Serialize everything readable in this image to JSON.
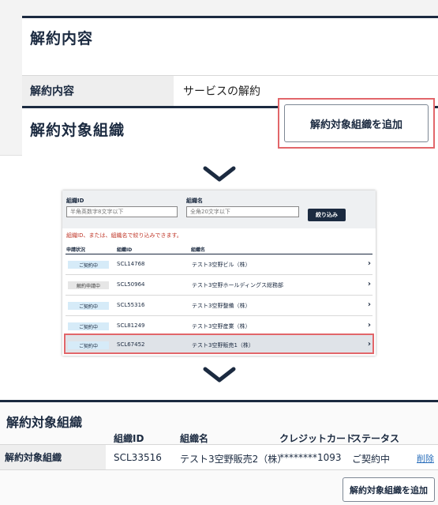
{
  "step1": {
    "section_title": "解約内容",
    "row_label": "解約内容",
    "row_value": "サービスの解約",
    "org_section_title": "解約対象組織",
    "add_button": "解約対象組織を追加"
  },
  "step2": {
    "org_id_label": "組織ID",
    "org_id_placeholder": "半角英数字8文字以下",
    "org_name_label": "組織名",
    "org_name_placeholder": "全角20文字以下",
    "filter_button": "絞り込み",
    "message": "組織ID、または、組織名で絞り込みできます。",
    "columns": [
      "申請状況",
      "組織ID",
      "組織名"
    ],
    "rows": [
      {
        "status": "ご契約中",
        "id": "SCL14768",
        "name": "テスト3空野ビル（株）"
      },
      {
        "status": "解約申請中",
        "id": "SCL50964",
        "name": "テスト3空野ホールディングス総務部"
      },
      {
        "status": "ご契約中",
        "id": "SCL55316",
        "name": "テスト3空野整備（株）"
      },
      {
        "status": "ご契約中",
        "id": "SCL81249",
        "name": "テスト3空野産業（株）"
      },
      {
        "status": "ご契約中",
        "id": "SCL67452",
        "name": "テスト3空野販売1（株）"
      }
    ],
    "arrow": "›"
  },
  "step3": {
    "title": "解約対象組織",
    "headers": [
      "組織ID",
      "組織名",
      "クレジットカード",
      "ステータス"
    ],
    "row_label": "解約対象組織",
    "row": {
      "id": "SCL33516",
      "name": "テスト3空野販売2（株）",
      "card": "********1093",
      "status": "ご契約中"
    },
    "delete_link": "削除",
    "add_button": "解約対象組織を追加"
  },
  "colors": {
    "navy": "#1b2a40",
    "highlight": "#e2666a",
    "error": "#c0392b",
    "link": "#2a6ebb"
  }
}
